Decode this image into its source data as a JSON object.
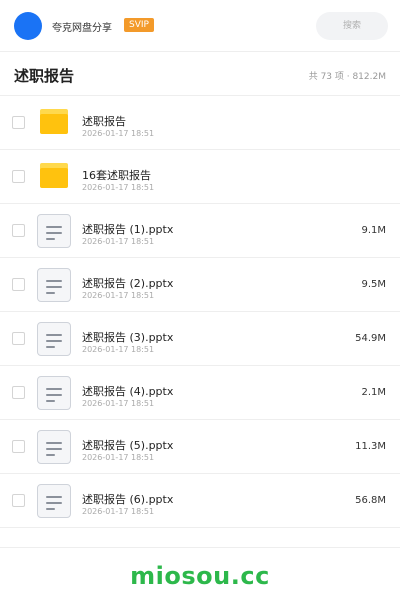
{
  "header": {
    "app_title": "夸克网盘分享",
    "badge": "SVIP",
    "search_label": "搜索"
  },
  "folder": {
    "title": "述职报告",
    "summary": "共 73 项 · 812.2M"
  },
  "files": [
    {
      "type": "folder",
      "name": "述职报告",
      "date": "2026-01-17 18:51",
      "size": ""
    },
    {
      "type": "folder",
      "name": "16套述职报告",
      "date": "2026-01-17 18:51",
      "size": ""
    },
    {
      "type": "document",
      "name": "述职报告 (1).pptx",
      "date": "2026-01-17 18:51",
      "size": "9.1M"
    },
    {
      "type": "document",
      "name": "述职报告 (2).pptx",
      "date": "2026-01-17 18:51",
      "size": "9.5M"
    },
    {
      "type": "document",
      "name": "述职报告 (3).pptx",
      "date": "2026-01-17 18:51",
      "size": "54.9M"
    },
    {
      "type": "document",
      "name": "述职报告 (4).pptx",
      "date": "2026-01-17 18:51",
      "size": "2.1M"
    },
    {
      "type": "document",
      "name": "述职报告 (5).pptx",
      "date": "2026-01-17 18:51",
      "size": "11.3M"
    },
    {
      "type": "document",
      "name": "述职报告 (6).pptx",
      "date": "2026-01-17 18:51",
      "size": "56.8M"
    }
  ],
  "footer": {
    "watermark": "miosou.cc"
  },
  "colors": {
    "accent": "#1a73f5",
    "badge": "#f39a2a",
    "folder": "#ffc20e",
    "watermark": "#2db84b"
  },
  "icons": {
    "folder": "folder-icon",
    "document": "document-icon"
  }
}
